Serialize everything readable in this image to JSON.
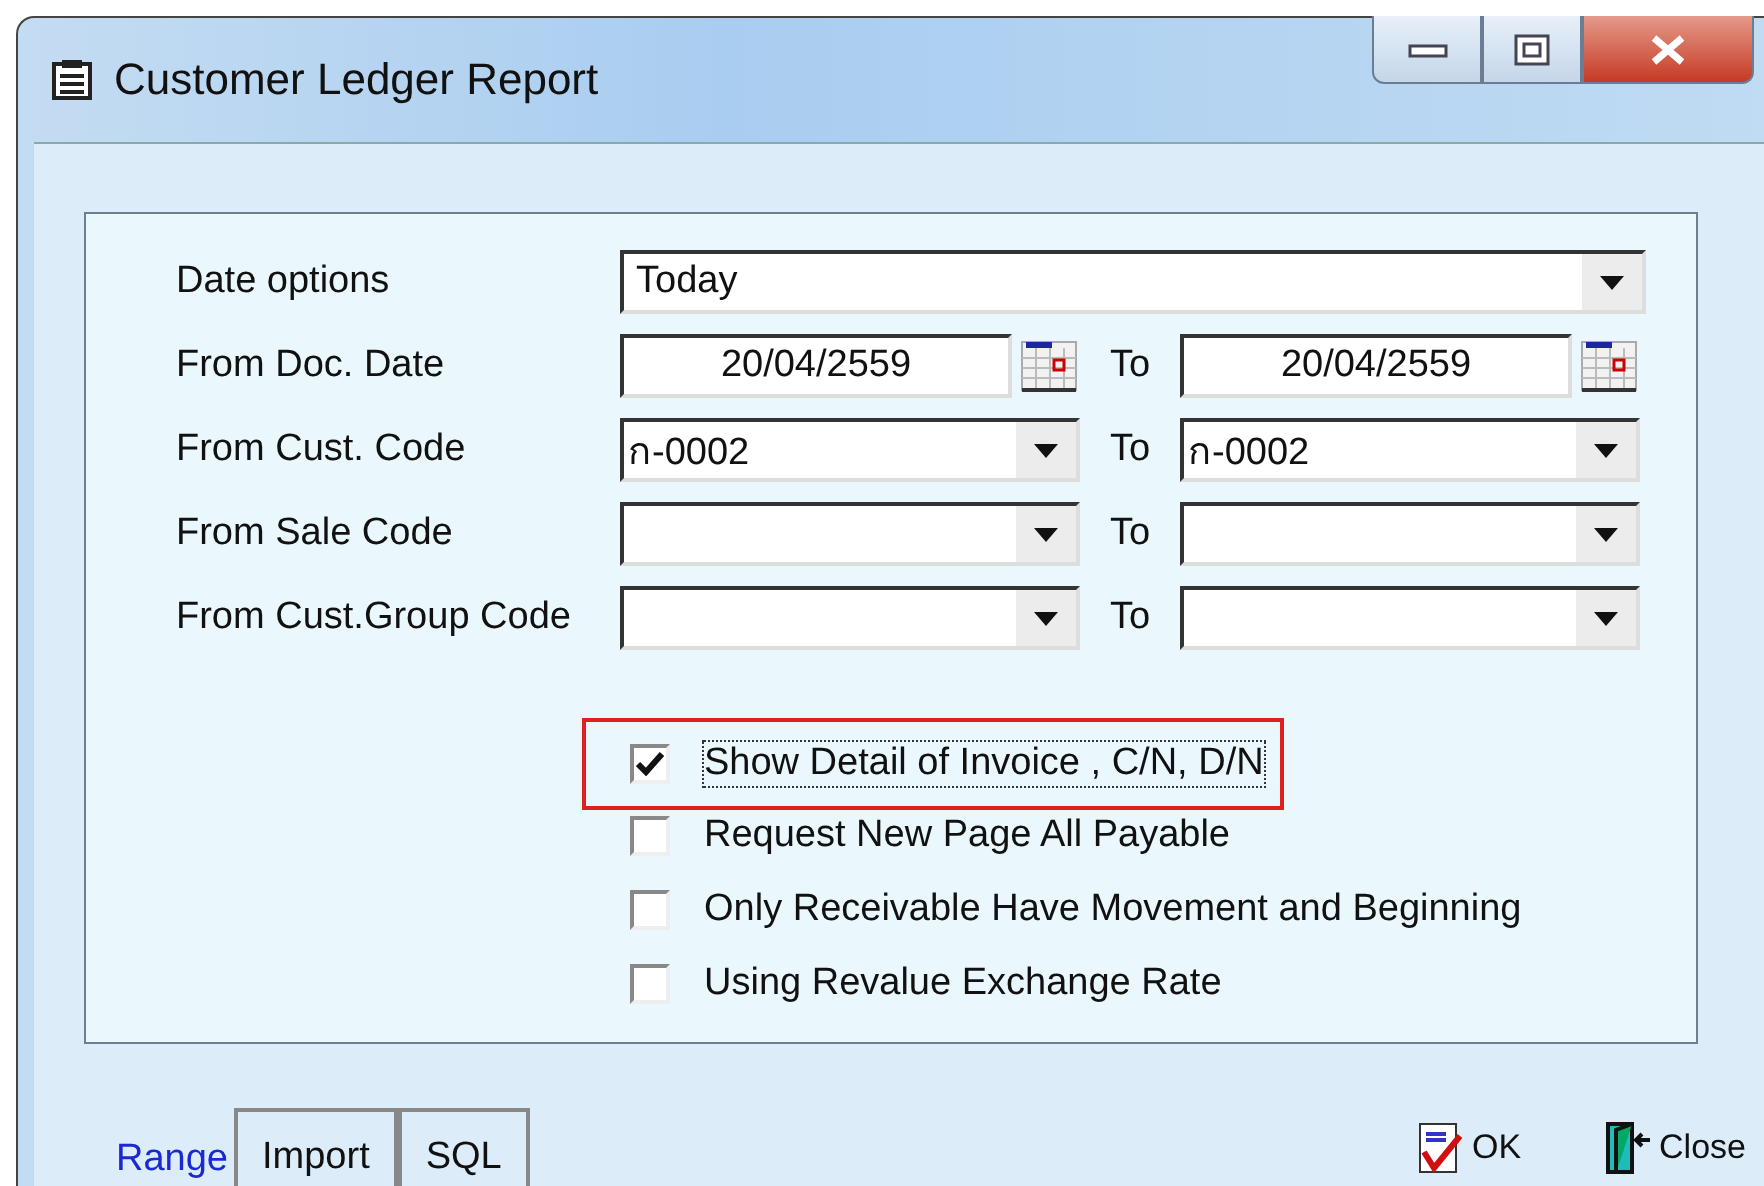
{
  "window": {
    "title": "Customer Ledger Report"
  },
  "rows": [
    {
      "label": "Date options",
      "from": {
        "kind": "combo",
        "value": "Today"
      }
    },
    {
      "label": "From Doc. Date",
      "from": {
        "kind": "date",
        "value": "20/04/2559"
      },
      "to_label": "To",
      "to": {
        "kind": "date",
        "value": "20/04/2559"
      }
    },
    {
      "label": "From Cust. Code",
      "from": {
        "kind": "combo",
        "value": "ก-0002"
      },
      "to_label": "To",
      "to": {
        "kind": "combo",
        "value": "ก-0002"
      }
    },
    {
      "label": "From Sale Code",
      "from": {
        "kind": "combo"
      },
      "to_label": "To",
      "to": {
        "kind": "combo"
      }
    },
    {
      "label": "From Cust.Group Code",
      "from": {
        "kind": "combo"
      },
      "to_label": "To",
      "to": {
        "kind": "combo"
      }
    }
  ],
  "options": [
    {
      "label": "Show Detail of Invoice , C/N, D/N",
      "checked": true,
      "highlighted": true
    },
    {
      "label": "Request New Page All Payable",
      "checked": false,
      "highlighted": false
    },
    {
      "label": "Only Receivable Have Movement and Beginning",
      "checked": false,
      "highlighted": false
    },
    {
      "label": "Using Revalue Exchange Rate",
      "checked": false,
      "highlighted": false
    }
  ],
  "tabs": [
    {
      "label": "Range",
      "selected": true
    },
    {
      "label": "Import",
      "selected": false
    },
    {
      "label": "SQL",
      "selected": false
    }
  ],
  "buttons": [
    {
      "kind": "ok",
      "label": "OK"
    },
    {
      "kind": "close",
      "label": "Close"
    }
  ]
}
